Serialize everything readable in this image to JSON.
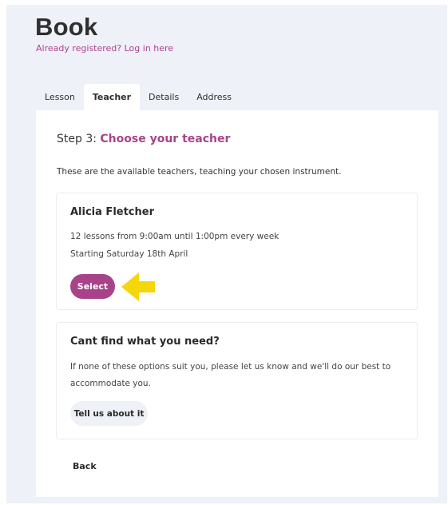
{
  "header": {
    "title": "Book",
    "login_link": "Already registered? Log in here"
  },
  "tabs": [
    {
      "label": "Lesson",
      "active": false
    },
    {
      "label": "Teacher",
      "active": true
    },
    {
      "label": "Details",
      "active": false
    },
    {
      "label": "Address",
      "active": false
    }
  ],
  "step": {
    "prefix": "Step 3: ",
    "title": "Choose your teacher",
    "intro": "These are the available teachers, teaching your chosen instrument."
  },
  "teacher_card": {
    "name": "Alicia Fletcher",
    "schedule": "12 lessons from 9:00am until 1:00pm every week",
    "start": "Starting Saturday 18th April",
    "select_label": "Select",
    "pointer_icon": "arrow-left-icon"
  },
  "help_card": {
    "title": "Cant find what you need?",
    "text": "If none of these options suit you, please let us know and we'll do our best to accommodate you.",
    "button_label": "Tell us about it"
  },
  "footer": {
    "back_label": "Back"
  },
  "colors": {
    "accent": "#a8438a",
    "arrow": "#f5d60a",
    "background": "#eef1f8"
  }
}
